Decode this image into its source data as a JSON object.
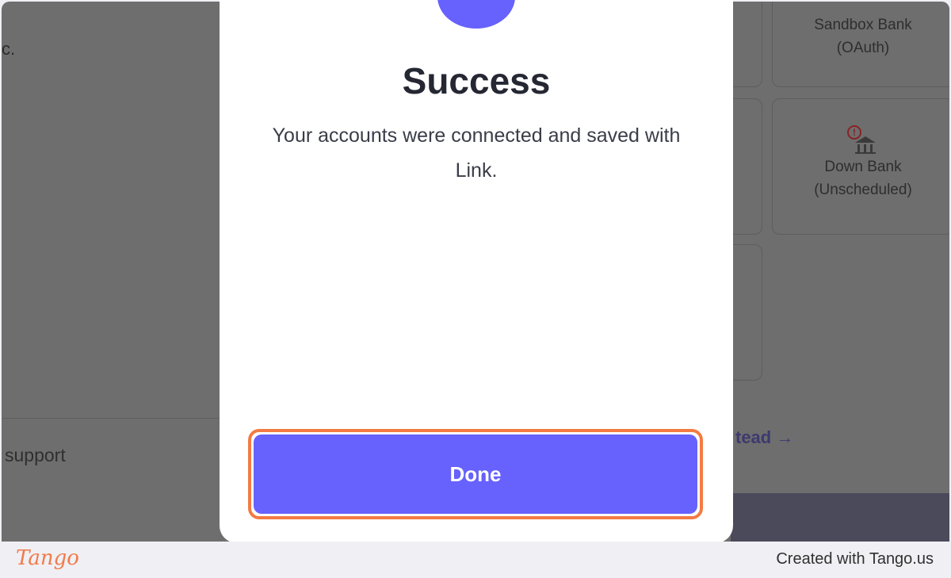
{
  "background": {
    "left_partial_text": "c.",
    "support_text": "support",
    "banks": [
      {
        "name": "Sandbox Bank",
        "sub": "(OAuth)"
      },
      {
        "name": "Down Bank",
        "sub": "(Unscheduled)"
      }
    ],
    "instead_link": "tead",
    "instead_arrow": "→"
  },
  "modal": {
    "title": "Success",
    "message": "Your accounts were connected and saved with Link.",
    "done_label": "Done"
  },
  "footer": {
    "logo": "Tango",
    "credit": "Created with Tango.us"
  },
  "colors": {
    "accent": "#6761fd",
    "highlight": "#f37b43",
    "logo": "#f07b4a"
  }
}
